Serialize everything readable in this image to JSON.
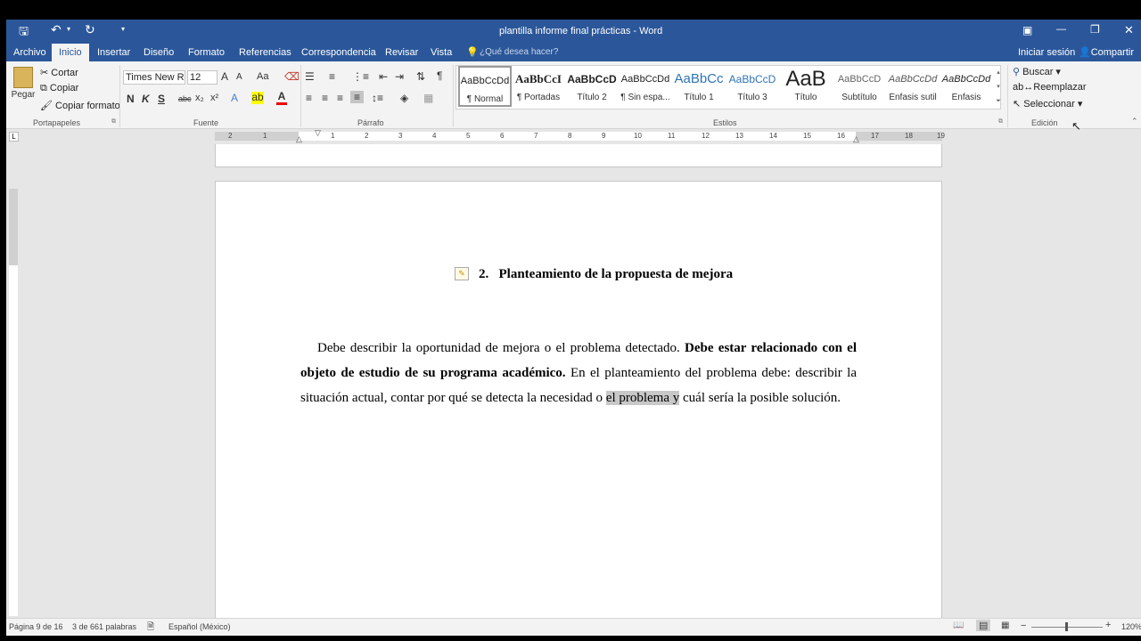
{
  "title": "plantilla informe final prácticas - Word",
  "window_controls": {
    "ribbon_opts": "▣",
    "minimize": "—",
    "restore": "❐",
    "close": "✕"
  },
  "qat": {
    "save": "🖫",
    "undo": "↶",
    "redo": "↻",
    "customize": "▾"
  },
  "tabs": [
    "Archivo",
    "Inicio",
    "Insertar",
    "Diseño",
    "Formato",
    "Referencias",
    "Correspondencia",
    "Revisar",
    "Vista"
  ],
  "tell_me": "¿Qué desea hacer?",
  "signin": "Iniciar sesión",
  "share": "Compartir",
  "clipboard": {
    "paste": "Pegar",
    "cut": "Cortar",
    "copy": "Copiar",
    "format_painter": "Copiar formato",
    "group": "Portapapeles"
  },
  "font": {
    "name": "Times New Ro",
    "size": "12",
    "bold": "N",
    "italic": "K",
    "underline": "S",
    "strike": "abc",
    "sub": "x₂",
    "sup": "x²",
    "case": "Aa",
    "grow": "A",
    "shrink": "A",
    "group": "Fuente"
  },
  "paragraph": {
    "group": "Párrafo",
    "pilcrow": "¶"
  },
  "styles": {
    "group": "Estilos",
    "items": [
      {
        "preview": "AaBbCcDd",
        "name": "¶ Normal"
      },
      {
        "preview": "AaBbCcI",
        "name": "¶ Portadas"
      },
      {
        "preview": "AaBbCcD",
        "name": "Título 2"
      },
      {
        "preview": "AaBbCcDd",
        "name": "¶ Sin espa..."
      },
      {
        "preview": "AaBbCc",
        "name": "Título 1"
      },
      {
        "preview": "AaBbCcD",
        "name": "Título 3"
      },
      {
        "preview": "AaB",
        "name": "Título"
      },
      {
        "preview": "AaBbCcD",
        "name": "Subtítulo"
      },
      {
        "preview": "AaBbCcDd",
        "name": "Énfasis sutil"
      },
      {
        "preview": "AaBbCcDd",
        "name": "Énfasis"
      }
    ]
  },
  "editing": {
    "find": "Buscar",
    "replace": "Reemplazar",
    "select": "Seleccionar",
    "group": "Edición"
  },
  "ruler": {
    "ticks": [
      "2",
      "1",
      "1",
      "2",
      "3",
      "4",
      "5",
      "6",
      "7",
      "8",
      "9",
      "10",
      "11",
      "12",
      "13",
      "14",
      "15",
      "16",
      "17",
      "18",
      "19"
    ]
  },
  "document": {
    "heading_number": "2.",
    "heading_text": "Planteamiento de la propuesta de mejora",
    "para_1": "Debe describir la oportunidad de mejora o el problema detectado.",
    "para_bold": "Debe estar relacionado con el objeto de estudio de su programa académico.",
    "para_2": "En el planteamiento del problema debe: describir la situación actual, contar por qué se detecta la necesidad o",
    "para_sel": "el problema y",
    "para_3": "cuál sería la posible solución."
  },
  "status": {
    "page": "Página 9 de 16",
    "words": "3 de 661 palabras",
    "lang": "Español (México)",
    "zoom": "120%"
  }
}
